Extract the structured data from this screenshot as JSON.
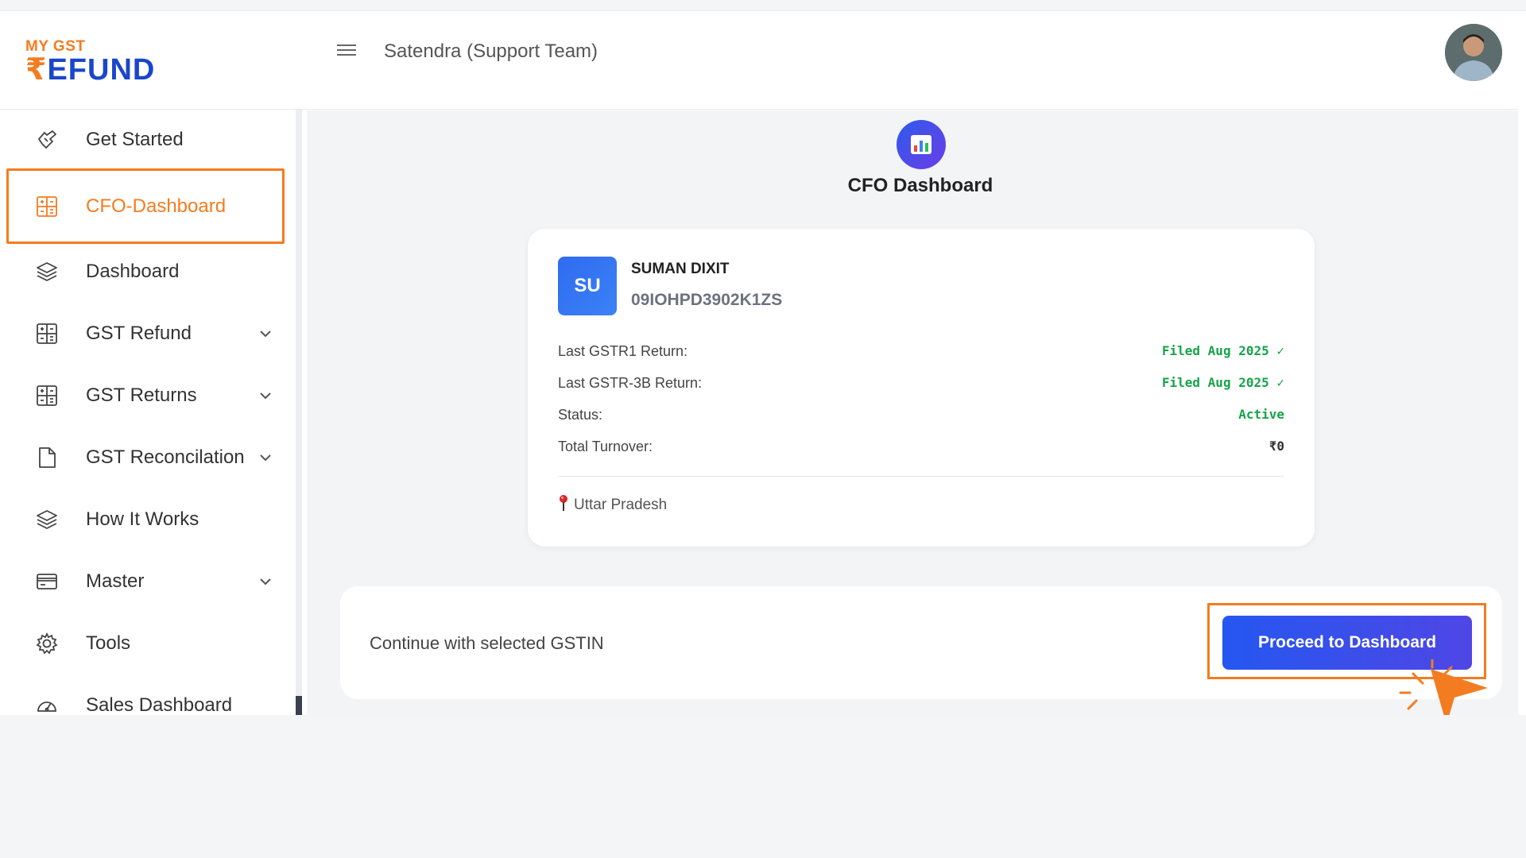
{
  "header": {
    "logo_top": "MY GST",
    "logo_rupee": "₹",
    "logo_bottom": "EFUND",
    "user_name": "Satendra (Support Team)"
  },
  "sidebar": {
    "items": [
      {
        "label": "Get Started",
        "icon": "hand-pointer-icon",
        "expandable": false
      },
      {
        "label": "CFO-Dashboard",
        "icon": "calculator-icon",
        "expandable": false,
        "active": true
      },
      {
        "label": "Dashboard",
        "icon": "layers-icon",
        "expandable": false
      },
      {
        "label": "GST Refund",
        "icon": "calculator-icon",
        "expandable": true
      },
      {
        "label": "GST Returns",
        "icon": "calculator-icon",
        "expandable": true
      },
      {
        "label": "GST Reconcilation",
        "icon": "document-icon",
        "expandable": true
      },
      {
        "label": "How It Works",
        "icon": "layers-icon",
        "expandable": false
      },
      {
        "label": "Master",
        "icon": "credit-card-icon",
        "expandable": true
      },
      {
        "label": "Tools",
        "icon": "gear-icon",
        "expandable": false
      },
      {
        "label": "Sales Dashboard",
        "icon": "gauge-icon",
        "expandable": false
      }
    ]
  },
  "main": {
    "title": "CFO Dashboard",
    "card": {
      "badge": "SU",
      "company": "SUMAN DIXIT",
      "gstin": "09IOHPD3902K1ZS",
      "rows": [
        {
          "key": "Last GSTR1 Return:",
          "value": "Filed Aug 2025 ✓"
        },
        {
          "key": "Last GSTR-3B Return:",
          "value": "Filed Aug 2025 ✓"
        },
        {
          "key": "Status:",
          "value": "Active"
        },
        {
          "key": "Total Turnover:",
          "value": "₹0"
        }
      ],
      "location": "Uttar Pradesh"
    },
    "continue_text": "Continue with selected GSTIN",
    "proceed_label": "Proceed to Dashboard"
  },
  "colors": {
    "accent_orange": "#f47c20",
    "brand_blue": "#1a47c9",
    "success_green": "#16a34a",
    "button_blue": "#2557f0"
  }
}
